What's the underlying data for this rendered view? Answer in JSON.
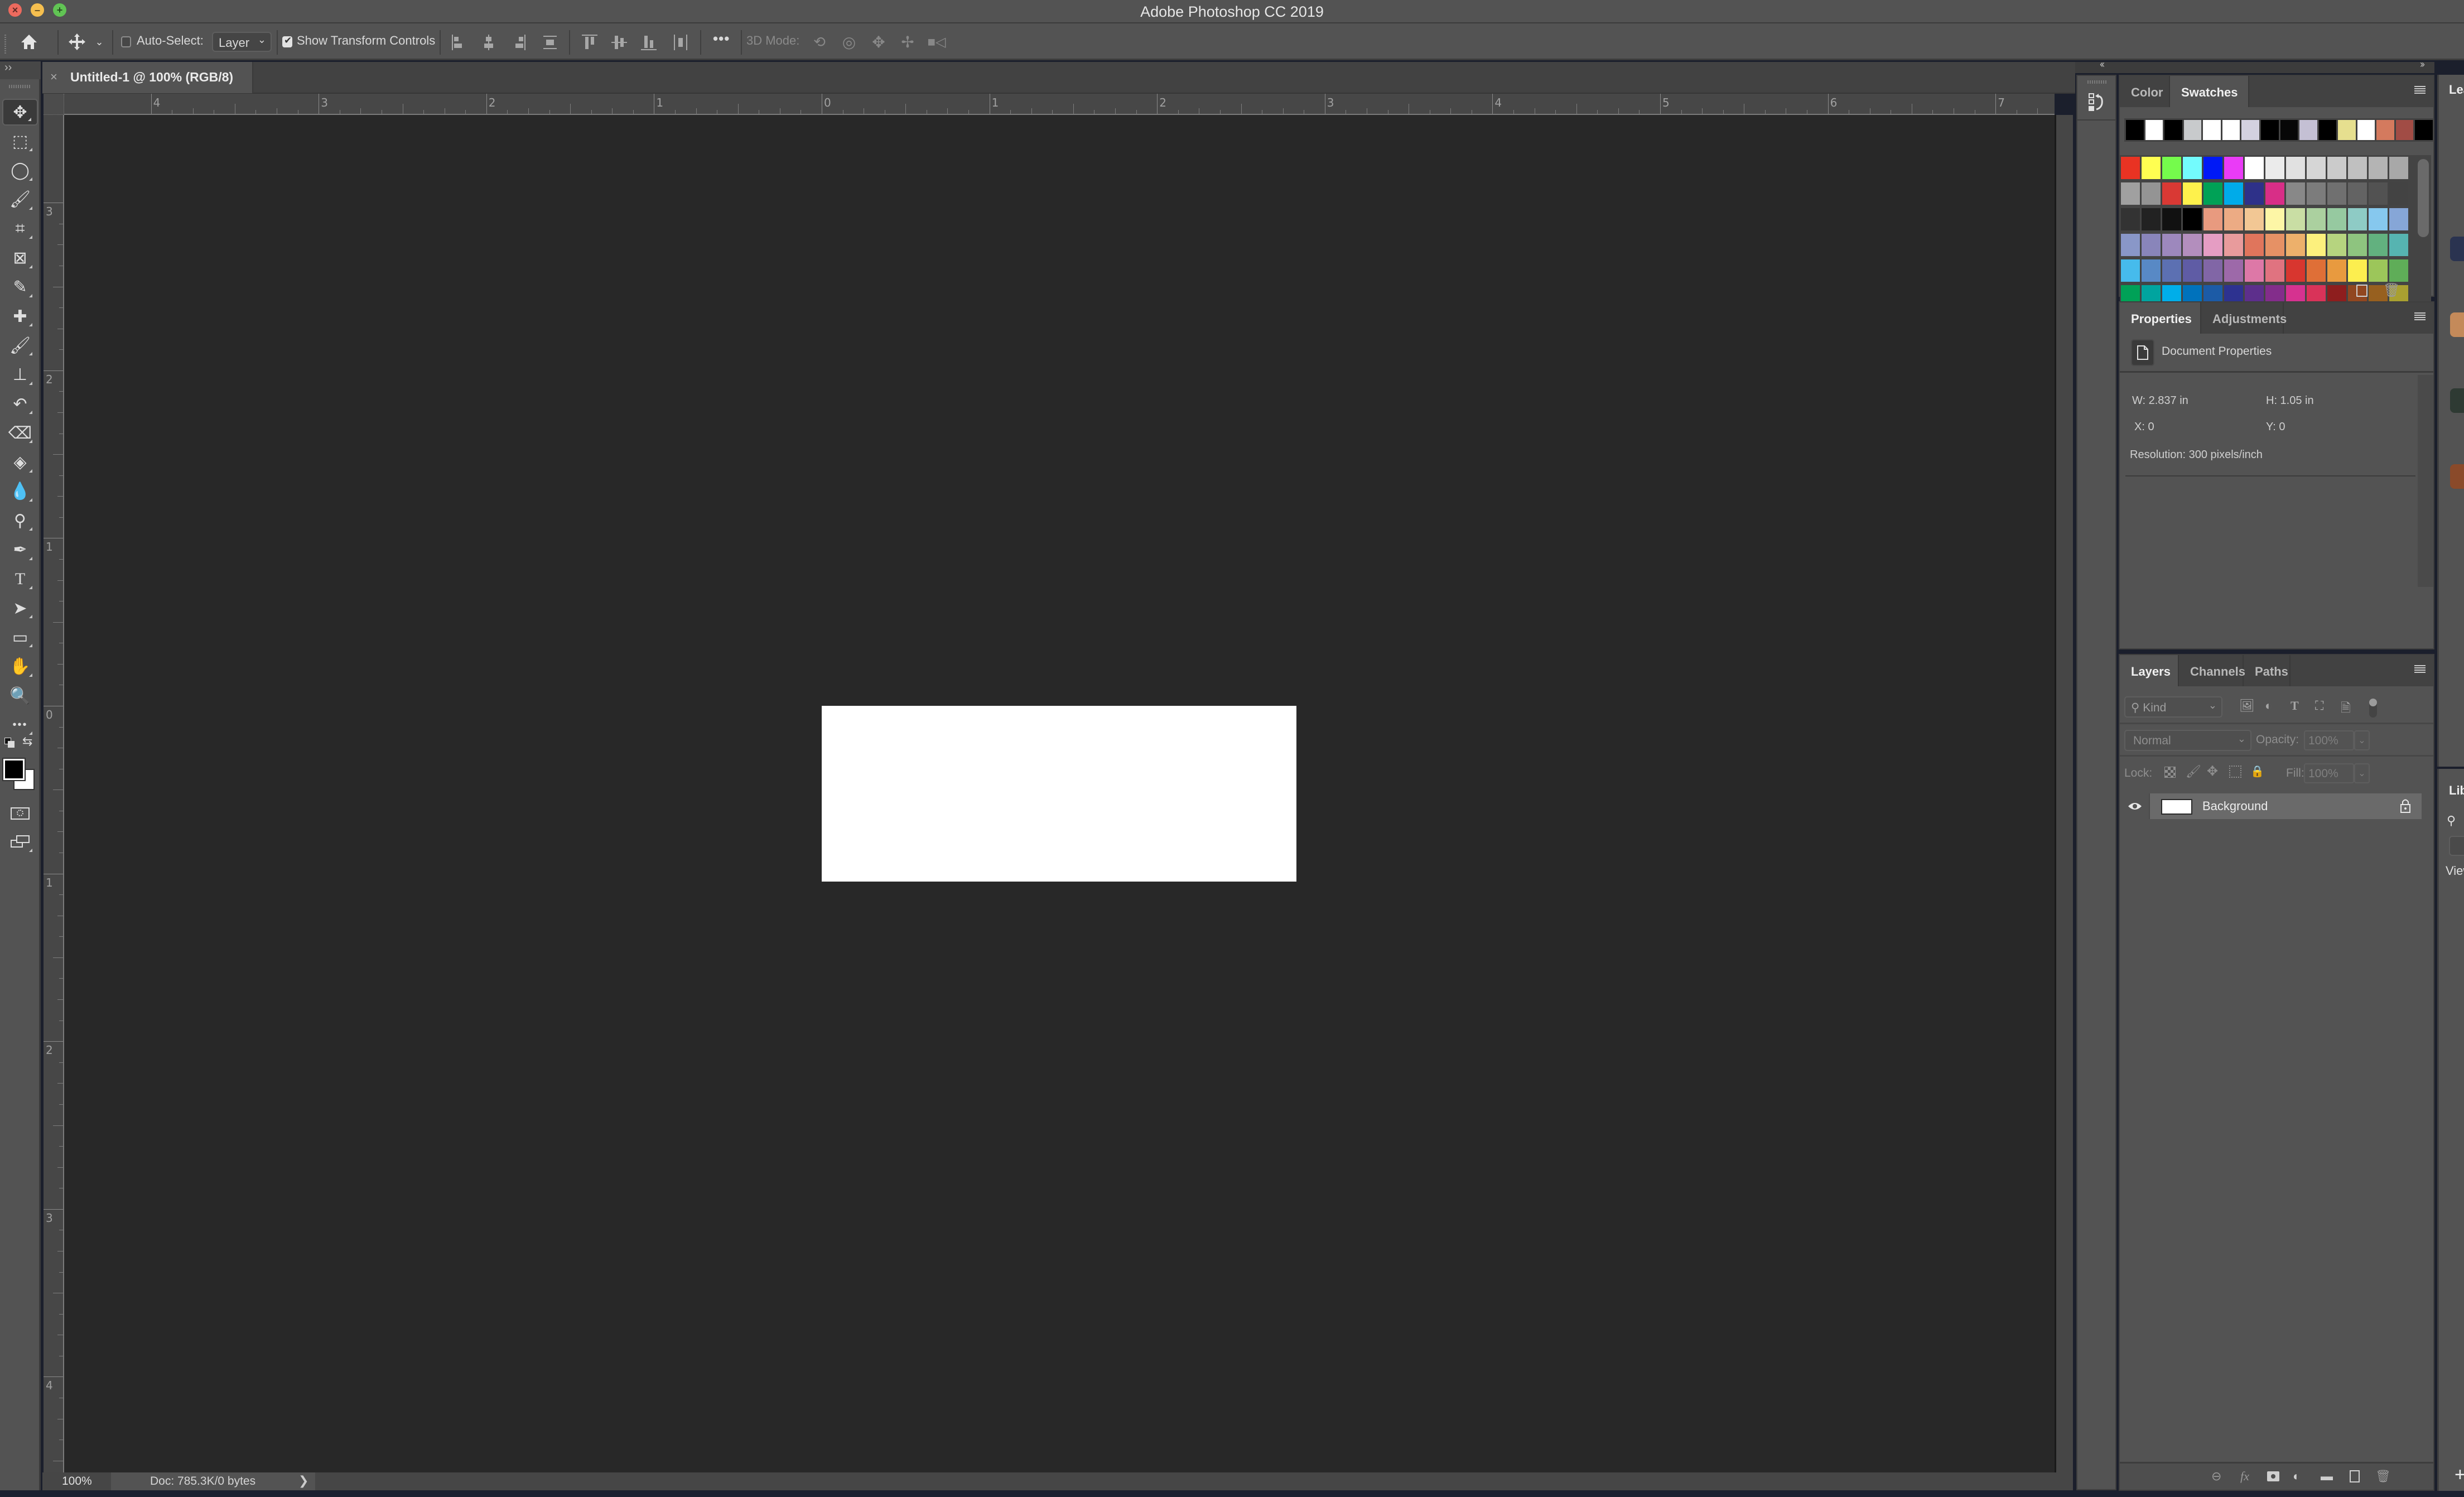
{
  "window": {
    "title": "Adobe Photoshop CC 2019"
  },
  "options_bar": {
    "auto_select_label": "Auto-Select:",
    "auto_select_checked": false,
    "auto_select_target": "Layer",
    "show_transform_label": "Show Transform Controls",
    "show_transform_checked": true,
    "more_label": "•••",
    "mode_3d_label": "3D Mode:",
    "icons": [
      "home-icon",
      "move-tool-icon",
      "chevron-down-icon",
      "align-left-edges-icon",
      "align-horizontal-centers-icon",
      "align-right-edges-icon",
      "distribute-vertical-icon",
      "align-top-edges-icon",
      "align-vertical-centers-icon",
      "align-bottom-edges-icon",
      "distribute-horizontal-icon",
      "more-icon",
      "orbit-3d-icon",
      "roll-3d-icon",
      "drag-3d-icon",
      "slide-3d-icon",
      "zoom-3d-camera-icon"
    ]
  },
  "document_tab": {
    "title": "Untitled-1 @ 100% (RGB/8)",
    "close_glyph": "×"
  },
  "toolbar": {
    "collapse_glyph": "››",
    "tools": [
      {
        "name": "move-tool",
        "glyph": "✥",
        "active": true
      },
      {
        "name": "rectangular-marquee-tool",
        "glyph": "⬚"
      },
      {
        "name": "lasso-tool",
        "glyph": "◯"
      },
      {
        "name": "quick-selection-tool",
        "glyph": "🖌"
      },
      {
        "name": "crop-tool",
        "glyph": "⌗"
      },
      {
        "name": "frame-tool",
        "glyph": "⊠"
      },
      {
        "name": "eyedropper-tool",
        "glyph": "✎"
      },
      {
        "name": "spot-healing-brush-tool",
        "glyph": "✚"
      },
      {
        "name": "brush-tool",
        "glyph": "🖌"
      },
      {
        "name": "clone-stamp-tool",
        "glyph": "⊥"
      },
      {
        "name": "history-brush-tool",
        "glyph": "↶"
      },
      {
        "name": "eraser-tool",
        "glyph": "⌫"
      },
      {
        "name": "paint-bucket-tool",
        "glyph": "◈"
      },
      {
        "name": "blur-tool",
        "glyph": "💧"
      },
      {
        "name": "dodge-tool",
        "glyph": "⚲"
      },
      {
        "name": "pen-tool",
        "glyph": "✒"
      },
      {
        "name": "type-tool",
        "glyph": "T"
      },
      {
        "name": "path-selection-tool",
        "glyph": "➤"
      },
      {
        "name": "rectangle-tool",
        "glyph": "▭"
      },
      {
        "name": "hand-tool",
        "glyph": "✋"
      },
      {
        "name": "zoom-tool",
        "glyph": "🔍"
      },
      {
        "name": "edit-toolbar",
        "glyph": "•••"
      }
    ],
    "swap_glyph": "⇆",
    "foreground_color": "#000000",
    "background_color": "#ffffff"
  },
  "rulers": {
    "unit": "in",
    "horizontal_labels": [
      "4",
      "3",
      "2",
      "1",
      "0",
      "1",
      "2",
      "3",
      "4",
      "5",
      "6",
      "7"
    ],
    "vertical_labels": [
      "3",
      "2",
      "1",
      "0",
      "1",
      "2",
      "3",
      "4"
    ]
  },
  "canvas": {
    "document_fill": "#ffffff",
    "pasteboard": "#282828"
  },
  "status_bar": {
    "zoom": "100%",
    "doc_info": "Doc: 785.3K/0 bytes",
    "arrow": "❯"
  },
  "dock": {
    "collapse_glyph": "‹‹",
    "expand_glyph": "››"
  },
  "swatches_panel": {
    "tabs": [
      {
        "label": "Color",
        "active": false
      },
      {
        "label": "Swatches",
        "active": true
      }
    ],
    "recent": [
      "#000000",
      "#ffffff",
      "#000000",
      "#c8cacc",
      "#ffffff",
      "#ffffff",
      "#d3d1e0",
      "#000000",
      "#070707",
      "#c4c0d4",
      "#000000",
      "#e6df8f",
      "#ffffff",
      "#d47a5e",
      "#a14c45",
      "#000000"
    ],
    "grid": [
      "#e93323",
      "#fffe51",
      "#75fb4c",
      "#73fbfd",
      "#0019f6",
      "#ea3bf7",
      "#ffffff",
      "#ebebeb",
      "#e1e1e1",
      "#d6d6d6",
      "#cbcbcb",
      "#c0c0c0",
      "#b4b4b4",
      "#a8a8a8",
      "#a0a0a0",
      "#949494",
      "#d93934",
      "#fef14c",
      "#00a156",
      "#00abe9",
      "#2e3189",
      "#d82e87",
      "#888888",
      "#7c7c7c",
      "#707070",
      "#636363",
      "#525252",
      "#434343",
      "#333333",
      "#222222",
      "#111111",
      "#000000",
      "#e89a7f",
      "#ecab84",
      "#f2c794",
      "#fdf6a6",
      "#c9dea4",
      "#abd09f",
      "#96c9a0",
      "#8ecbc5",
      "#86c8ee",
      "#86a6d7",
      "#8997c8",
      "#8985ba",
      "#9d88bd",
      "#b38ebd",
      "#e59dc3",
      "#e89b9c",
      "#e0755c",
      "#e69165",
      "#edb06b",
      "#fcf07d",
      "#b6d47f",
      "#8ec47f",
      "#62b17f",
      "#56b4b1",
      "#46bbec",
      "#5889c5",
      "#5c70b2",
      "#5f5ca5",
      "#8166a6",
      "#9d69a9",
      "#dd78a7",
      "#e07380",
      "#d8362f",
      "#df6f37",
      "#e89a3f",
      "#fcee4f",
      "#9cc65a",
      "#5fad58",
      "#00a157",
      "#00a49f",
      "#00aee9",
      "#0072bc",
      "#1c5ba6",
      "#2d3290",
      "#5d2f8c",
      "#832d8b",
      "#d63290",
      "#d93359",
      "#8e1e1e",
      "#914720",
      "#97601f",
      "#a9a031"
    ],
    "new_swatch_icon": "new-swatch-icon",
    "delete_icon": "trash-icon"
  },
  "properties_panel": {
    "tabs": [
      {
        "label": "Properties",
        "active": true
      },
      {
        "label": "Adjustments",
        "active": false
      }
    ],
    "section_title": "Document Properties",
    "width": "W:  2.837 in",
    "height": "H:  1.05 in",
    "x": "X:  0",
    "y": "Y:  0",
    "resolution": "Resolution: 300 pixels/inch"
  },
  "layers_panel": {
    "tabs": [
      {
        "label": "Layers",
        "active": true
      },
      {
        "label": "Channels",
        "active": false
      },
      {
        "label": "Paths",
        "active": false
      }
    ],
    "filter_kind": "Kind",
    "filter_icons": [
      "pixel-layer-filter-icon",
      "adjustment-layer-filter-icon",
      "type-layer-filter-icon",
      "shape-layer-filter-icon",
      "smart-object-filter-icon"
    ],
    "blend_mode": "Normal",
    "opacity_label": "Opacity:",
    "opacity_value": "100%",
    "lock_label": "Lock:",
    "fill_label": "Fill:",
    "fill_value": "100%",
    "layers": [
      {
        "name": "Background",
        "visible": true,
        "locked": true,
        "thumb_color": "#ffffff"
      }
    ],
    "footer_icons": [
      "link-layers-icon",
      "fx-icon",
      "layer-mask-icon",
      "adjustment-layer-icon",
      "group-folder-icon",
      "new-layer-icon",
      "trash-icon"
    ]
  },
  "learn_panel": {
    "title": "Learn",
    "thumb_colors": [
      "#2a3350",
      "#c48a5a",
      "#2e3a33",
      "#8a4a2a"
    ]
  },
  "libraries_panel": {
    "title": "Libraries",
    "view_label": "View",
    "add_glyph": "+"
  }
}
